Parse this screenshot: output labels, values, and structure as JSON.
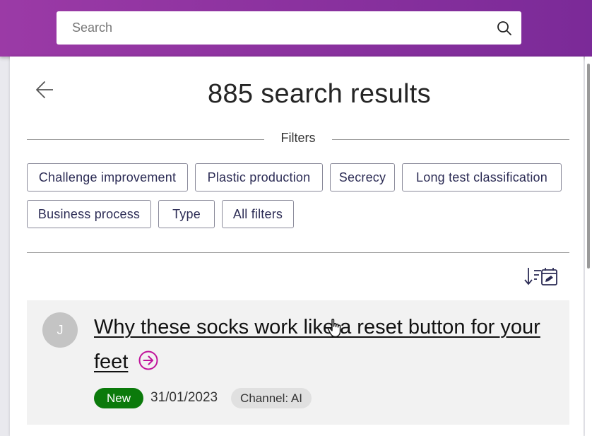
{
  "header": {
    "search": {
      "placeholder": "Search",
      "value": ""
    },
    "accent_color": "#9b3aa6"
  },
  "results": {
    "title": "885 search results",
    "filters_label": "Filters",
    "filter_chips": [
      "Challenge improvement",
      "Plastic production",
      "Secrecy",
      "Long test classification",
      "Business process",
      "Type",
      "All filters"
    ],
    "sort_icon": "sort-by-date-icon",
    "items": [
      {
        "avatar_initial": "J",
        "title": "Why these socks work like a reset button for your feet",
        "badge": "New",
        "date": "31/01/2023",
        "channel": "Channel: AI",
        "badge_color": "#0b7a0b",
        "link_icon": "arrow-circle-right-icon",
        "link_icon_color": "#c0139b"
      }
    ]
  }
}
